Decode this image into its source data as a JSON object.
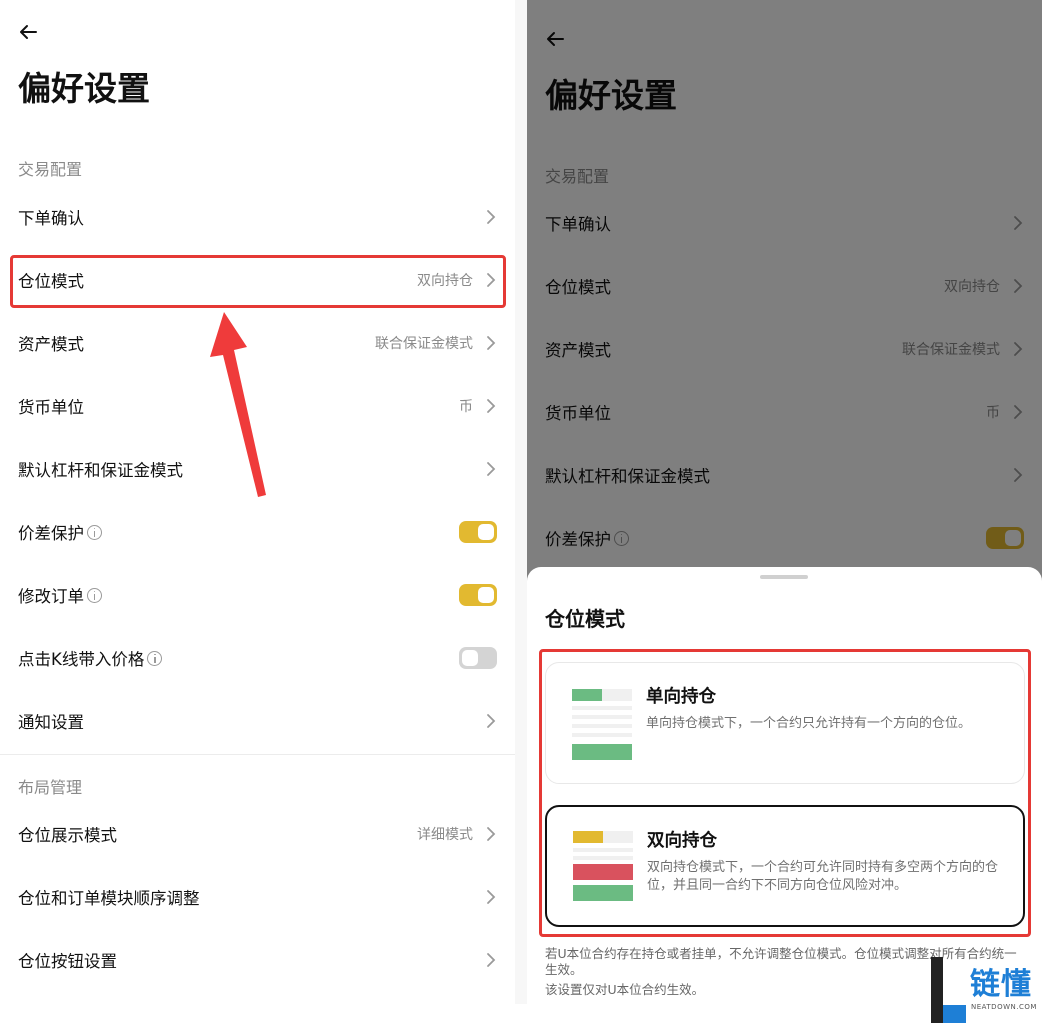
{
  "page": {
    "title": "偏好设置",
    "section_trade": "交易配置",
    "section_layout": "布局管理",
    "back_icon": "arrow-left-icon"
  },
  "rows": {
    "order_confirm": {
      "label": "下单确认"
    },
    "position_mode": {
      "label": "仓位模式",
      "value": "双向持仓"
    },
    "asset_mode": {
      "label": "资产模式",
      "value": "联合保证金模式"
    },
    "currency_unit": {
      "label": "货币单位",
      "value": "币"
    },
    "default_leverage": {
      "label": "默认杠杆和保证金模式"
    },
    "price_protect": {
      "label": "价差保护",
      "toggle": true
    },
    "modify_order": {
      "label": "修改订单",
      "toggle": true
    },
    "kline_price": {
      "label": "点击K线带入价格",
      "toggle": false
    },
    "notify": {
      "label": "通知设置"
    },
    "position_display": {
      "label": "仓位展示模式",
      "value": "详细模式"
    },
    "module_order": {
      "label": "仓位和订单模块顺序调整"
    },
    "position_buttons": {
      "label": "仓位按钮设置"
    }
  },
  "sheet": {
    "title": "仓位模式",
    "one_way": {
      "title": "单向持仓",
      "desc": "单向持仓模式下，一个合约只允许持有一个方向的仓位。"
    },
    "hedge": {
      "title": "双向持仓",
      "desc": "双向持仓模式下，一个合约可允许同时持有多空两个方向的仓位，并且同一合约下不同方向仓位风险对冲。"
    },
    "footnote_1": "若U本位合约存在持仓或者挂单，不允许调整仓位模式。仓位模式调整对所有合约统一生效。",
    "footnote_2": "该设置仅对U本位合约生效。"
  },
  "watermark": {
    "cn": "链懂",
    "en": "NEATDOWN.COM"
  },
  "colors": {
    "accent_yellow": "#e2b930",
    "toggle_off": "#d4d4d4",
    "highlight_red": "#e53935",
    "green": "#6bbb82",
    "red": "#d9525e",
    "yellow": "#e2b930"
  }
}
